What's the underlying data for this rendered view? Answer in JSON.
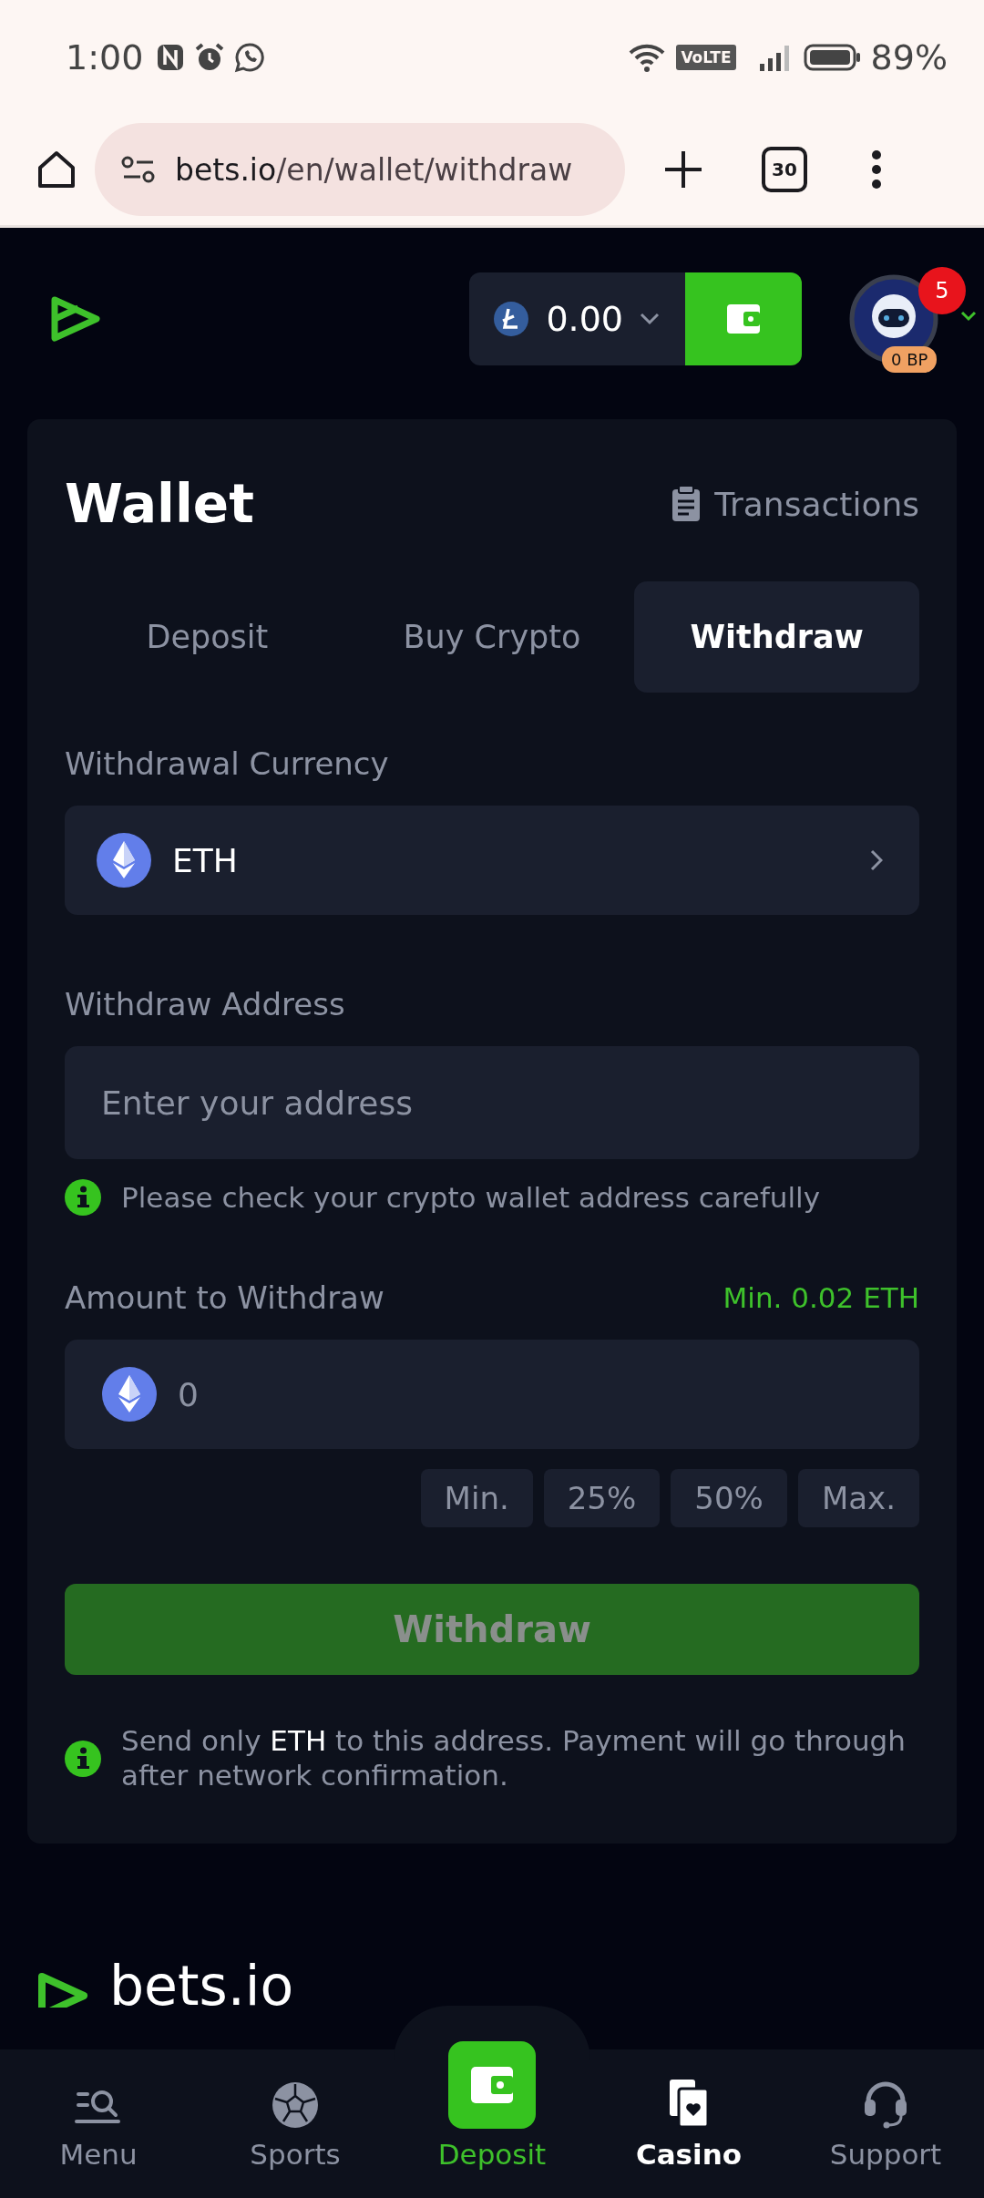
{
  "status_bar": {
    "time": "1:00",
    "battery": "89%",
    "network_badge": "VoLTE"
  },
  "browser": {
    "url_host": "bets.io",
    "url_path": "/en/wallet/withdraw",
    "tab_count": "30"
  },
  "header": {
    "balance": "0.00",
    "notifications": "5",
    "points": "0 BP"
  },
  "wallet": {
    "title": "Wallet",
    "transactions_link": "Transactions",
    "tabs": [
      {
        "label": "Deposit",
        "selected": false
      },
      {
        "label": "Buy Crypto",
        "selected": false
      },
      {
        "label": "Withdraw",
        "selected": true
      }
    ],
    "currency_label": "Withdrawal Currency",
    "currency": "ETH",
    "address_label": "Withdraw Address",
    "address_placeholder": "Enter your address",
    "address_note": "Please check your crypto wallet address carefully",
    "amount_label": "Amount to Withdraw",
    "amount_min": "Min. 0.02 ETH",
    "amount_value": "0",
    "presets": [
      "Min.",
      "25%",
      "50%",
      "Max."
    ],
    "submit": {
      "label": "Withdraw",
      "disabled": true
    },
    "footer_note": "Send only **ETH** to this address. Payment will go through after network confirmation."
  },
  "footer": {
    "brand": "bets.io"
  },
  "bottom_nav": [
    {
      "label": "Menu",
      "kind": "menu",
      "selected": false
    },
    {
      "label": "Sports",
      "kind": "sports",
      "selected": false
    },
    {
      "label": "Deposit",
      "kind": "deposit",
      "selected": false
    },
    {
      "label": "Casino",
      "kind": "casino",
      "selected": true
    },
    {
      "label": "Support",
      "kind": "support",
      "selected": false
    }
  ]
}
